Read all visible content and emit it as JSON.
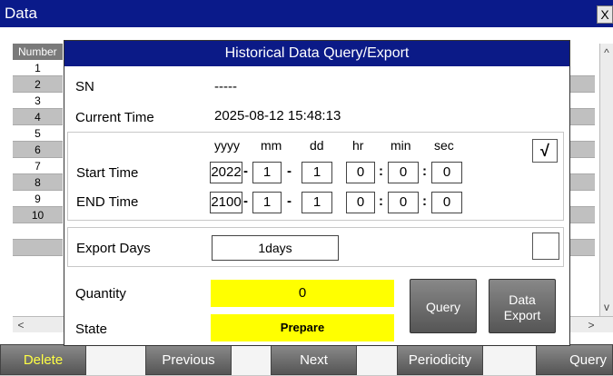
{
  "window": {
    "title": "Data",
    "close_label": "X"
  },
  "background_table": {
    "header": "Number",
    "rows": [
      "1",
      "2",
      "3",
      "4",
      "5",
      "6",
      "7",
      "8",
      "9",
      "10",
      "",
      ""
    ]
  },
  "scroll": {
    "up": "^",
    "down": "v",
    "left": "<",
    "right": ">"
  },
  "toolbar": {
    "delete": "Delete",
    "previous": "Previous",
    "next": "Next",
    "periodicity": "Periodicity",
    "query": "Query"
  },
  "dialog": {
    "title": "Historical Data Query/Export",
    "sn_label": "SN",
    "sn_value": "-----",
    "current_time_label": "Current Time",
    "current_time_value": "2025-08-12 15:48:13",
    "headers": {
      "yyyy": "yyyy",
      "mm": "mm",
      "dd": "dd",
      "hr": "hr",
      "min": "min",
      "sec": "sec"
    },
    "time_checkbox": "√",
    "start": {
      "label": "Start Time",
      "yyyy": "2022",
      "mm": "1",
      "dd": "1",
      "hr": "0",
      "min": "0",
      "sec": "0"
    },
    "end": {
      "label": "END Time",
      "yyyy": "2100",
      "mm": "1",
      "dd": "1",
      "hr": "0",
      "min": "0",
      "sec": "0"
    },
    "date_sep": "-",
    "time_sep": ":",
    "export_days_label": "Export Days",
    "export_days_value": "1days",
    "export_checkbox": "",
    "quantity_label": "Quantity",
    "quantity_value": "0",
    "state_label": "State",
    "state_value": "Prepare",
    "query_button": "Query",
    "export_button_line1": "Data",
    "export_button_line2": "Export"
  },
  "colors": {
    "titlebar": "#0a1a8a",
    "highlight": "#ffff00",
    "delete_text": "#ffff44"
  }
}
